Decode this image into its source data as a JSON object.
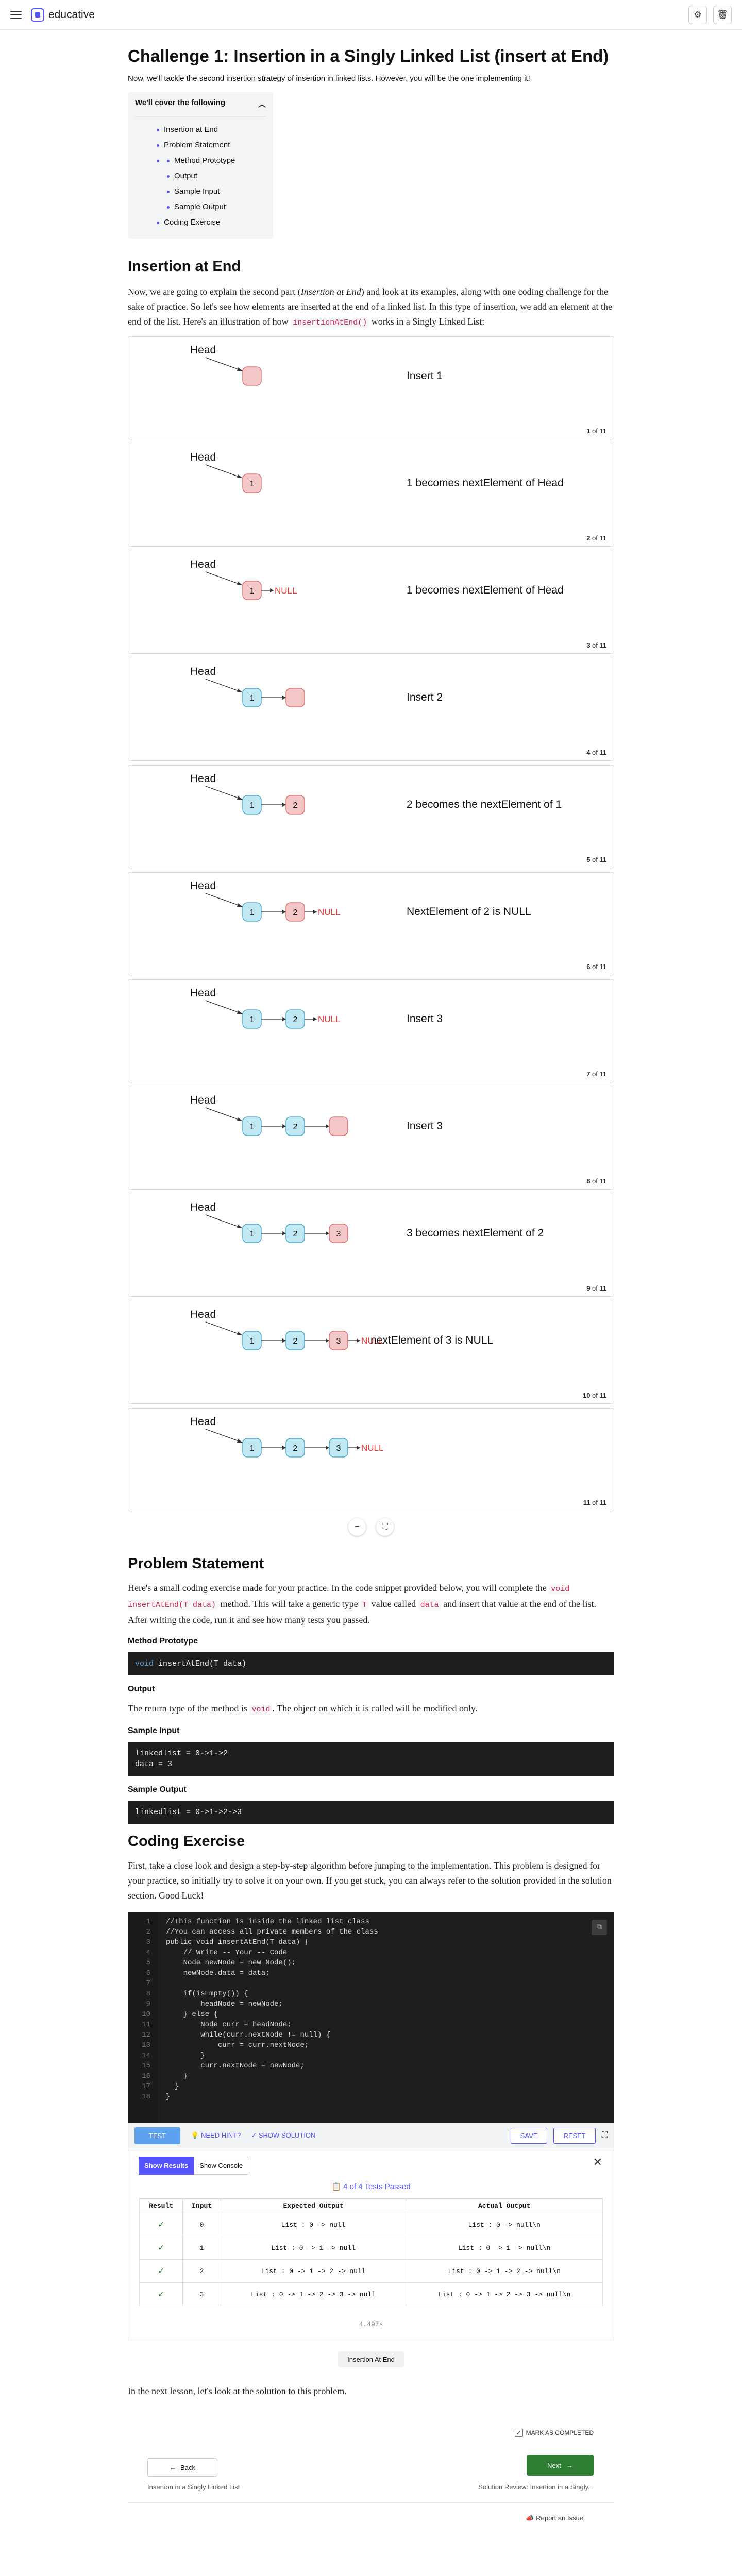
{
  "brand": {
    "name": "educative"
  },
  "header": {
    "title": "Challenge 1: Insertion in a Singly Linked List (insert at End)",
    "intro": "Now, we'll tackle the second insertion strategy of insertion in linked lists. However, you will be the one implementing it!"
  },
  "toc": {
    "title": "We'll cover the following",
    "items": [
      "Insertion at End",
      "Problem Statement",
      "Method Prototype",
      "Output",
      "Sample Input",
      "Sample Output",
      "Coding Exercise"
    ]
  },
  "insertion": {
    "heading": "Insertion at End",
    "p1": "Now, we are going to explain the second part (",
    "p1_em": "Insertion at End",
    "p2": ") and look at its examples, along with one coding challenge for the sake of practice. So let's see how elements are inserted at the end of a linked list. In this type of insertion, we add an element at the end of the list. Here's an illustration of how ",
    "p2_code": "insertionAtEnd()",
    "p3": " works in a Singly Linked List:"
  },
  "slides": {
    "head_label": "Head",
    "null_label": "NULL",
    "of_word": "of",
    "total": "11",
    "items": [
      {
        "num": "1",
        "nodes": [
          ""
        ],
        "null": false,
        "caption": "Insert 1"
      },
      {
        "num": "2",
        "nodes": [
          "1"
        ],
        "null": false,
        "caption": "1 becomes nextElement of Head"
      },
      {
        "num": "3",
        "nodes": [
          "1"
        ],
        "null": true,
        "caption": "1 becomes nextElement of Head"
      },
      {
        "num": "4",
        "nodes": [
          "1",
          ""
        ],
        "null": false,
        "caption": "Insert 2"
      },
      {
        "num": "5",
        "nodes": [
          "1",
          "2"
        ],
        "null": false,
        "caption": "2 becomes the nextElement of 1"
      },
      {
        "num": "6",
        "nodes": [
          "1",
          "2"
        ],
        "null": true,
        "caption": "NextElement of 2 is NULL"
      },
      {
        "num": "7",
        "nodes": [
          "1",
          "2"
        ],
        "null": true,
        "caption": "Insert 3"
      },
      {
        "num": "8",
        "nodes": [
          "1",
          "2",
          ""
        ],
        "null": false,
        "caption": "Insert 3"
      },
      {
        "num": "9",
        "nodes": [
          "1",
          "2",
          "3"
        ],
        "null": false,
        "caption": "3 becomes nextElement of 2"
      },
      {
        "num": "10",
        "nodes": [
          "1",
          "2",
          "3"
        ],
        "null": true,
        "caption": "nextElement of 3 is NULL"
      },
      {
        "num": "11",
        "nodes": [
          "1",
          "2",
          "3"
        ],
        "null": true,
        "caption": ""
      }
    ]
  },
  "colors": {
    "accent": "#5553ff",
    "node_blue": "#bfe8f3",
    "node_blue_stroke": "#3aa3c6",
    "node_red": "#f3c7c7",
    "node_red_stroke": "#d66",
    "null_red": "#e53935"
  },
  "problem": {
    "heading": "Problem Statement",
    "p1": "Here's a small coding exercise made for your practice. In the code snippet provided below, you will complete the ",
    "p1_code": "void insertAtEnd(T data)",
    "p2": " method. This will take a generic type ",
    "p2_code": "T",
    "p3": " value called ",
    "p3_code": "data",
    "p4": " and insert that value at the end of the list. After writing the code, run it and see how many tests you passed."
  },
  "prototype": {
    "heading": "Method Prototype",
    "code_kw": "void",
    "code_rest": " insertAtEnd(T data)"
  },
  "output": {
    "heading": "Output",
    "p1": "The return type of the method is ",
    "p1_code": "void",
    "p2": ". The object on which it is called will be modified only."
  },
  "sample_input": {
    "heading": "Sample Input",
    "line1": "linkedlist = 0->1->2",
    "line2": "data = 3"
  },
  "sample_output": {
    "heading": "Sample Output",
    "line1": "linkedlist = 0->1->2->3"
  },
  "coding": {
    "heading": "Coding Exercise",
    "p": "First, take a close look and design a step-by-step algorithm before jumping to the implementation. This problem is designed for your practice, so initially try to solve it on your own. If you get stuck, you can always refer to the solution provided in the solution section. Good Luck!"
  },
  "editor": {
    "lines": [
      {
        "n": "1",
        "t": "//This function is inside the linked list class",
        "c": "cm"
      },
      {
        "n": "2",
        "t": "//You can access all private members of the class",
        "c": "cm"
      },
      {
        "n": "3",
        "t": "public void insertAtEnd(T data) {",
        "c": ""
      },
      {
        "n": "4",
        "t": "    // Write -- Your -- Code",
        "c": "cm"
      },
      {
        "n": "5",
        "t": "    Node newNode = new Node();",
        "c": ""
      },
      {
        "n": "6",
        "t": "    newNode.data = data;",
        "c": ""
      },
      {
        "n": "7",
        "t": "",
        "c": ""
      },
      {
        "n": "8",
        "t": "    if(isEmpty()) {",
        "c": ""
      },
      {
        "n": "9",
        "t": "        headNode = newNode;",
        "c": ""
      },
      {
        "n": "10",
        "t": "    } else {",
        "c": ""
      },
      {
        "n": "11",
        "t": "        Node curr = headNode;",
        "c": ""
      },
      {
        "n": "12",
        "t": "        while(curr.nextNode != null) {",
        "c": ""
      },
      {
        "n": "13",
        "t": "            curr = curr.nextNode;",
        "c": ""
      },
      {
        "n": "14",
        "t": "        }",
        "c": ""
      },
      {
        "n": "15",
        "t": "        curr.nextNode = newNode;",
        "c": ""
      },
      {
        "n": "16",
        "t": "    }",
        "c": ""
      },
      {
        "n": "17",
        "t": "  }",
        "c": ""
      },
      {
        "n": "18",
        "t": "}",
        "c": ""
      }
    ]
  },
  "toolbar": {
    "test": "TEST",
    "hint": "NEED HINT?",
    "solution": "SHOW SOLUTION",
    "save": "SAVE",
    "reset": "RESET"
  },
  "results": {
    "tab_results": "Show Results",
    "tab_console": "Show Console",
    "passed": "4 of 4 Tests Passed",
    "headers": [
      "Result",
      "Input",
      "Expected Output",
      "Actual Output"
    ],
    "rows": [
      {
        "input": "0",
        "expected": "List : 0 -> null",
        "actual": "List : 0 -> null\\n"
      },
      {
        "input": "1",
        "expected": "List : 0 -> 1 -> null",
        "actual": "List : 0 -> 1 -> null\\n"
      },
      {
        "input": "2",
        "expected": "List : 0 -> 1 -> 2 -> null",
        "actual": "List : 0 -> 1 -> 2 -> null\\n"
      },
      {
        "input": "3",
        "expected": "List : 0 -> 1 -> 2 -> 3 -> null",
        "actual": "List : 0 -> 1 -> 2 -> 3 -> null\\n"
      }
    ],
    "timing": "4.497s"
  },
  "tag": "Insertion At End",
  "closing": "In the next lesson, let's look at the solution to this problem.",
  "nav": {
    "mark_complete": "MARK AS COMPLETED",
    "back": "Back",
    "next": "Next",
    "prev_title": "Insertion in a Singly Linked List",
    "next_title": "Solution Review: Insertion in a Singly...",
    "report": "Report an Issue"
  }
}
